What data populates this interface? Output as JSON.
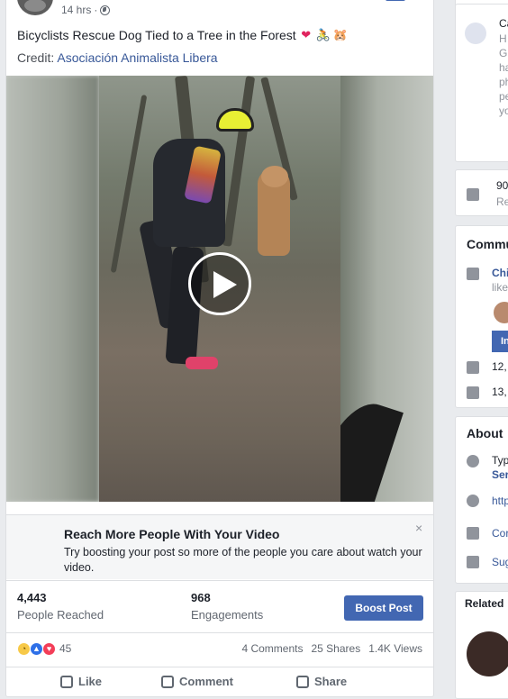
{
  "post": {
    "timestamp": "14 hrs",
    "separator": "·",
    "title": "Bicyclists Rescue Dog Tied to a Tree in the Forest",
    "title_emojis": [
      "❤",
      "🚴",
      "🐹"
    ],
    "credit_label": "Credit:",
    "credit_link": "Asociación Animalista Libera"
  },
  "boost_banner": {
    "title": "Reach More People With Your Video",
    "description": "Try boosting your post so more of the people you care about watch your video.",
    "close": "×"
  },
  "stats": {
    "reached_value": "4,443",
    "reached_label": "People Reached",
    "engagements_value": "968",
    "engagements_label": "Engagements",
    "boost_button": "Boost Post"
  },
  "reactions": {
    "count": "45",
    "comments": "4 Comments",
    "shares": "25 Shares",
    "views": "1.4K Views"
  },
  "actions": {
    "like": "Like",
    "comment": "Comment",
    "share": "Share"
  },
  "sidebar": {
    "group_title_fragment": "Ca",
    "group_lines": [
      "H",
      "G",
      "ha",
      "ph",
      "pe",
      "yo"
    ],
    "engagement_count": "90",
    "engagement_sub": "Re",
    "community_heading": "Commu",
    "community_item": "Chi",
    "community_item_sub": "like",
    "invite_fragment": "In",
    "likes_count": "12,",
    "follows_count": "13,",
    "about_heading": "About",
    "about_type": "Typ",
    "about_type_link": "Ser",
    "about_website": "http",
    "about_contact": "Cor",
    "about_suggest": "Sug",
    "related_heading": "Related"
  }
}
